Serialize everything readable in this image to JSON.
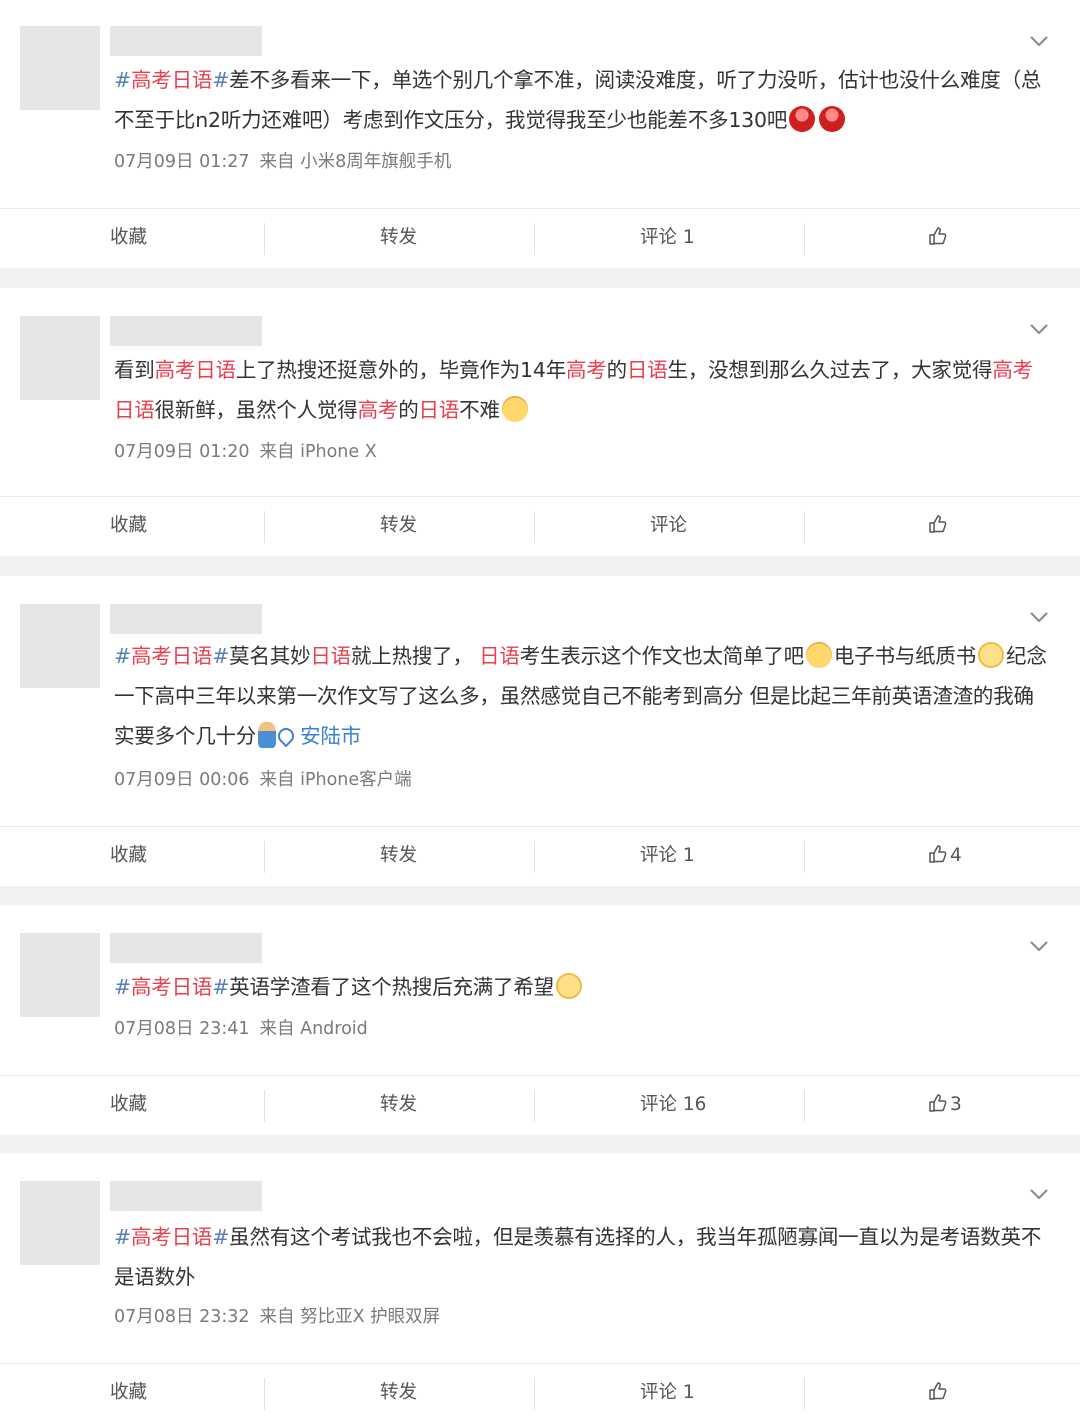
{
  "posts": [
    {
      "segments": [
        {
          "text": "#高考日语#",
          "cls": "tag-hl"
        },
        {
          "text": "差不多看来一下，单选个别几个拿不准，阅读没难度，听了力没听，估计也没什么难度（总不至于比n2听力还难吧）考虑到作文压分，我觉得我至少也能差不多130吧",
          "cls": ""
        }
      ],
      "emoji": [
        "red",
        "red"
      ],
      "date": "07月09日 01:27",
      "source": "来自 小米8周年旗舰手机",
      "actions": {
        "fav": "收藏",
        "repost": "转发",
        "comment": "评论 1",
        "like": ""
      }
    },
    {
      "segments": [
        {
          "text": "看到",
          "cls": ""
        },
        {
          "text": "高考日语",
          "cls": "hl"
        },
        {
          "text": "上了热搜还挺意外的，毕竟作为14年",
          "cls": ""
        },
        {
          "text": "高考",
          "cls": "hl"
        },
        {
          "text": "的",
          "cls": ""
        },
        {
          "text": "日语",
          "cls": "hl"
        },
        {
          "text": "生，没想到那么久过去了，大家觉得",
          "cls": ""
        },
        {
          "text": "高考日语",
          "cls": "hl"
        },
        {
          "text": "很新鲜，虽然个人觉得",
          "cls": ""
        },
        {
          "text": "高考",
          "cls": "hl"
        },
        {
          "text": "的",
          "cls": ""
        },
        {
          "text": "日语",
          "cls": "hl"
        },
        {
          "text": "不难",
          "cls": ""
        }
      ],
      "emoji": [
        "cat"
      ],
      "date": "07月09日 01:20",
      "source": "来自 iPhone X",
      "actions": {
        "fav": "收藏",
        "repost": "转发",
        "comment": "评论",
        "like": ""
      }
    },
    {
      "segments": [
        {
          "text": "#高考日语#",
          "cls": "tag-hl"
        },
        {
          "text": "莫名其妙",
          "cls": ""
        },
        {
          "text": "日语",
          "cls": "hl"
        },
        {
          "text": "就上热搜了， ",
          "cls": ""
        },
        {
          "text": "日语",
          "cls": "hl"
        },
        {
          "text": "考生表示这个作文也太简单了吧",
          "cls": ""
        },
        {
          "text": "",
          "cls": "emo-cat"
        },
        {
          "text": "电子书与纸质书",
          "cls": ""
        },
        {
          "text": "",
          "cls": "emo-face"
        },
        {
          "text": "纪念一下高中三年以来第一次作文写了这么多，虽然感觉自己不能考到高分 但是比起三年前英语渣渣的我确实要多个几十分",
          "cls": ""
        },
        {
          "text": "",
          "cls": "emo-figure"
        },
        {
          "text": "安陆市",
          "cls": "loc"
        }
      ],
      "emoji": [],
      "date": "07月09日 00:06",
      "source": "来自 iPhone客户端",
      "actions": {
        "fav": "收藏",
        "repost": "转发",
        "comment": "评论 1",
        "like": "4"
      }
    },
    {
      "segments": [
        {
          "text": "#高考日语#",
          "cls": "tag-hl"
        },
        {
          "text": "英语学渣看了这个热搜后充满了希望",
          "cls": ""
        }
      ],
      "emoji": [
        "face"
      ],
      "date": "07月08日 23:41",
      "source": "来自 Android",
      "actions": {
        "fav": "收藏",
        "repost": "转发",
        "comment": "评论 16",
        "like": "3"
      }
    },
    {
      "segments": [
        {
          "text": "#高考日语#",
          "cls": "tag-hl"
        },
        {
          "text": "虽然有这个考试我也不会啦，但是羡慕有选择的人，我当年孤陋寡闻一直以为是考语数英不是语数外",
          "cls": ""
        }
      ],
      "emoji": [],
      "date": "07月08日 23:32",
      "source": "来自 努比亚X 护眼双屏",
      "actions": {
        "fav": "收藏",
        "repost": "转发",
        "comment": "评论 1",
        "like": ""
      }
    }
  ],
  "icons": {
    "more": "chevron-down-icon",
    "like": "thumbs-up-icon",
    "location": "location-pin-icon"
  },
  "colors": {
    "highlight": "#e8404f",
    "hashtag": "#5a7fb8",
    "location": "#3b7fd4",
    "meta": "#7a7a7a"
  }
}
